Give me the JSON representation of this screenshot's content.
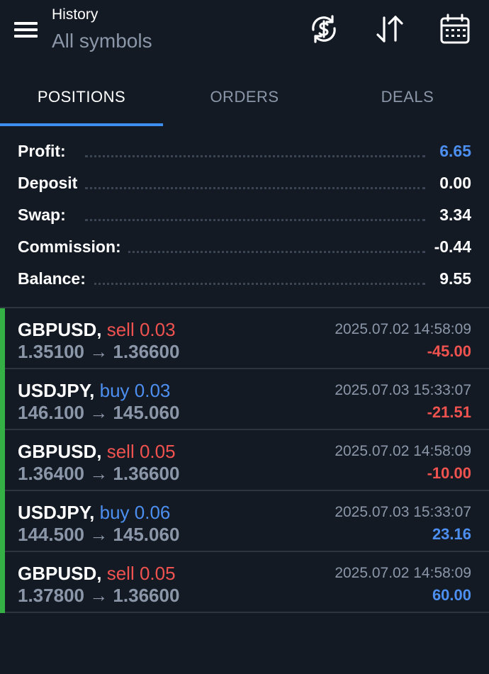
{
  "header": {
    "title_small": "History",
    "title_main": "All symbols",
    "icons": [
      "menu-icon",
      "currency-exchange-icon",
      "sort-icon",
      "calendar-icon"
    ]
  },
  "tabs": [
    {
      "label": "POSITIONS",
      "active": true
    },
    {
      "label": "ORDERS",
      "active": false
    },
    {
      "label": "DEALS",
      "active": false
    }
  ],
  "summary": [
    {
      "label": "Profit:",
      "value": "6.65",
      "color": "#4d8ff0"
    },
    {
      "label": "Deposit",
      "value": "0.00",
      "color": "#ffffff"
    },
    {
      "label": "Swap:",
      "value": "3.34",
      "color": "#ffffff"
    },
    {
      "label": "Commission:",
      "value": "-0.44",
      "color": "#ffffff"
    },
    {
      "label": "Balance:",
      "value": "9.55",
      "color": "#ffffff"
    }
  ],
  "positions": [
    {
      "symbol": "GBPUSD,",
      "side": "sell 0.03",
      "type": "sell",
      "prices": "1.35100 → 1.36600",
      "time": "2025.07.02 14:58:09",
      "profit": "-45.00"
    },
    {
      "symbol": "USDJPY,",
      "side": "buy 0.03",
      "type": "buy",
      "prices": "146.100 → 145.060",
      "time": "2025.07.03 15:33:07",
      "profit": "-21.51"
    },
    {
      "symbol": "GBPUSD,",
      "side": "sell 0.05",
      "type": "sell",
      "prices": "1.36400 → 1.36600",
      "time": "2025.07.02 14:58:09",
      "profit": "-10.00"
    },
    {
      "symbol": "USDJPY,",
      "side": "buy 0.06",
      "type": "buy",
      "prices": "144.500 → 145.060",
      "time": "2025.07.03 15:33:07",
      "profit": "23.16"
    },
    {
      "symbol": "GBPUSD,",
      "side": "sell 0.05",
      "type": "sell",
      "prices": "1.37800 → 1.36600",
      "time": "2025.07.02 14:58:09",
      "profit": "60.00"
    }
  ],
  "colors": {
    "accent": "#3d8ef0",
    "sell": "#f0534f",
    "buy": "#4d8ff0",
    "bar": "#34b044",
    "background": "#131a24"
  }
}
